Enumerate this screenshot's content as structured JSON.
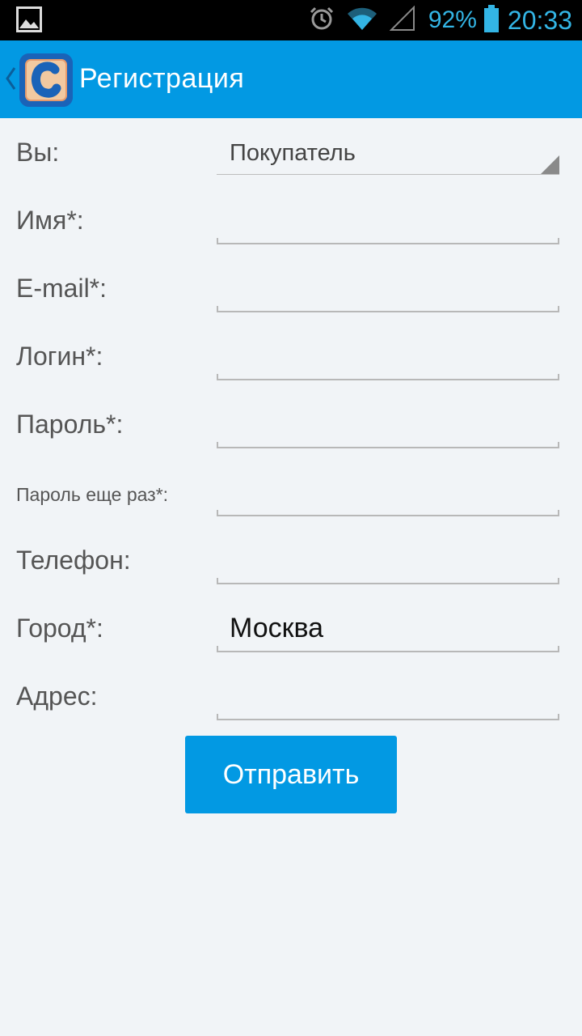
{
  "status_bar": {
    "battery_percent": "92%",
    "clock": "20:33",
    "icons": [
      "image-icon",
      "alarm-icon",
      "wifi-icon",
      "signal-icon",
      "battery-icon"
    ],
    "color": "#33b5e5"
  },
  "action_bar": {
    "title": "Регистрация",
    "background": "#0299e3"
  },
  "form": {
    "user_type": {
      "label": "Вы:",
      "value": "Покупатель"
    },
    "name": {
      "label": "Имя*:",
      "value": ""
    },
    "email": {
      "label": "E-mail*:",
      "value": ""
    },
    "login": {
      "label": "Логин*:",
      "value": ""
    },
    "password": {
      "label": "Пароль*:",
      "value": ""
    },
    "password_repeat": {
      "label": "Пароль еще раз*:",
      "value": ""
    },
    "phone": {
      "label": "Телефон:",
      "value": ""
    },
    "city": {
      "label": "Город*:",
      "value": "Москва"
    },
    "address": {
      "label": "Адрес:",
      "value": ""
    }
  },
  "submit": {
    "label": "Отправить"
  }
}
